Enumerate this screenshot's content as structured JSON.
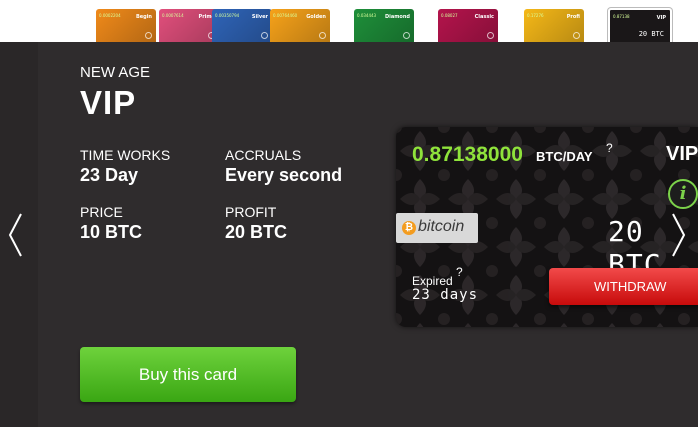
{
  "top_cards": [
    {
      "name": "Begin",
      "value": "0.0002204",
      "color": "#f08a1a"
    },
    {
      "name": "Prime",
      "value": "0.0007614",
      "color": "#e14f7c"
    },
    {
      "name": "Silver",
      "value": "0.00350794",
      "color": "#2f64b8"
    },
    {
      "name": "Golden",
      "value": "0.00764460",
      "color": "#f6a21a"
    },
    {
      "name": "Diamond",
      "value": "0.034443",
      "color": "#1e8f3a"
    },
    {
      "name": "Classic",
      "value": "0.08027",
      "color": "#b4144c"
    },
    {
      "name": "Profi",
      "value": "0.17276",
      "color": "#f5b818"
    },
    {
      "name": "VIP",
      "value": "0.87138",
      "color": "#1a1718"
    }
  ],
  "card_info": {
    "subtitle": "NEW AGE",
    "title": "VIP",
    "time_works_label": "TIME WORKS",
    "time_works_value": "23 Day",
    "accruals_label": "ACCRUALS",
    "accruals_value": "Every second",
    "price_label": "PRICE",
    "price_value": "10 BTC",
    "profit_label": "PROFIT",
    "profit_value": "20 BTC"
  },
  "buy_button": "Buy this card",
  "card": {
    "rate": "0.87138000",
    "rate_unit": "BTC/DAY",
    "help": "?",
    "name": "VIP",
    "info": "i",
    "brand": "bitcoin",
    "amount": "20 BTC",
    "expired_label": "Expired",
    "expired_value": "23 days",
    "withdraw_label": "WITHDRAW"
  }
}
